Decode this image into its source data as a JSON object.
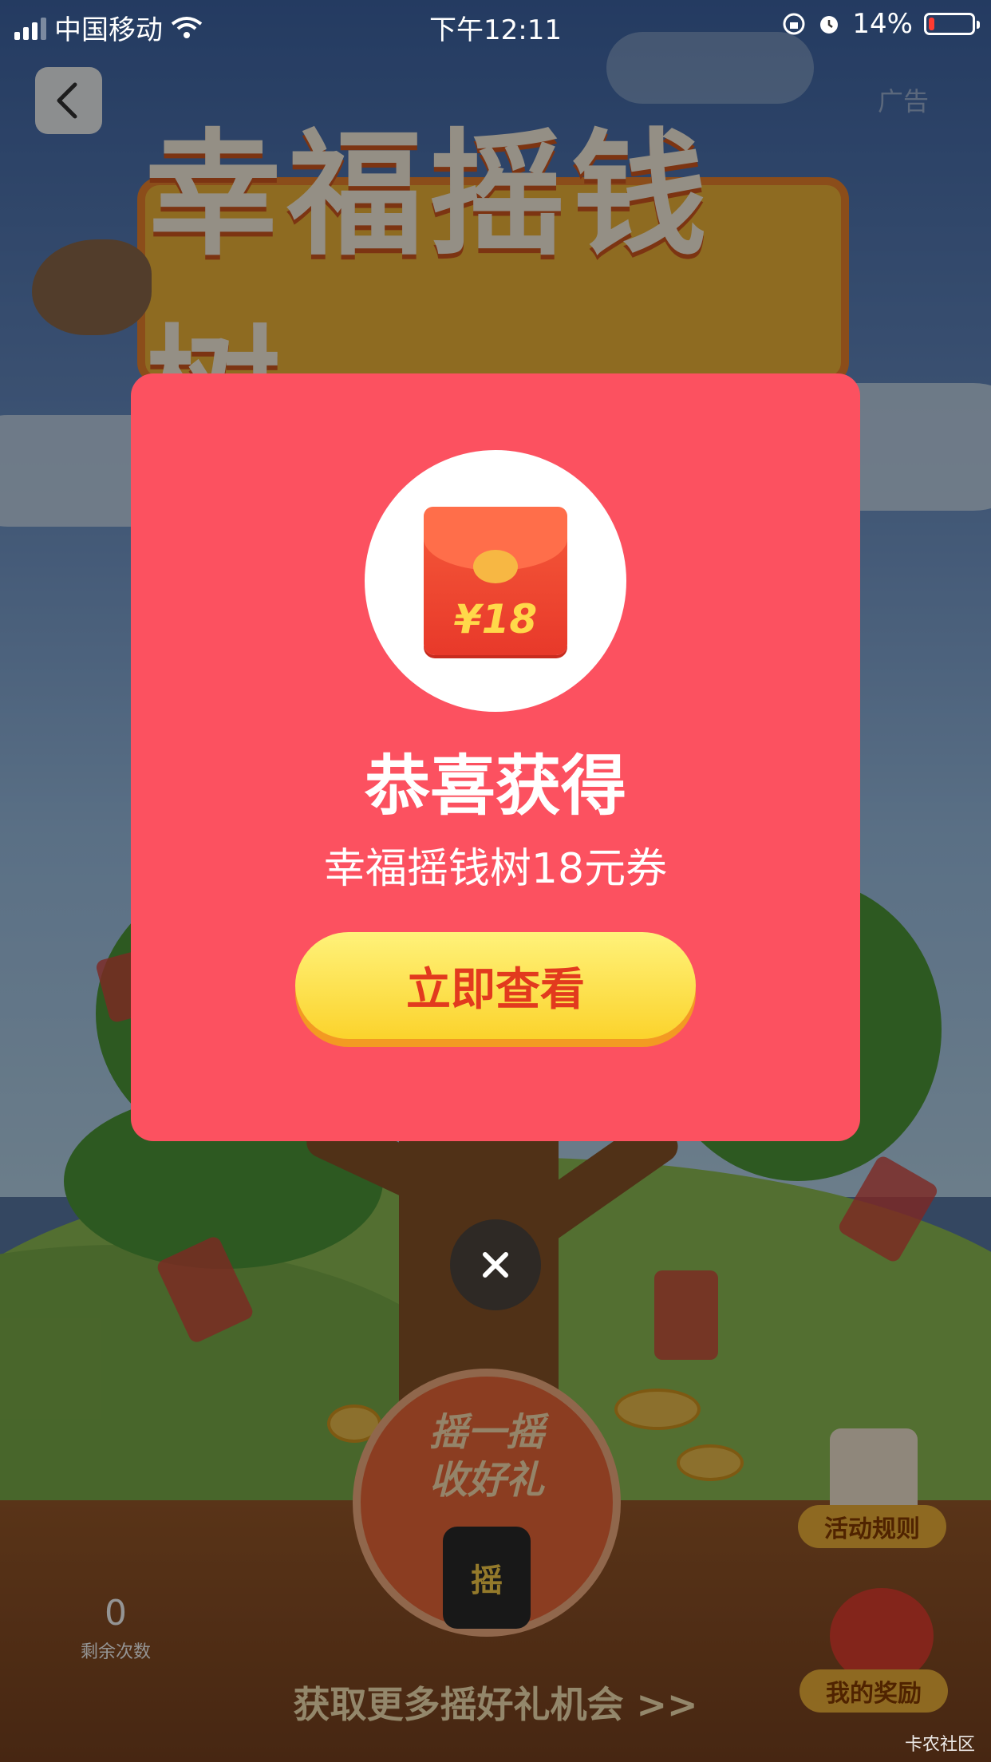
{
  "status_bar": {
    "carrier": "中国移动",
    "time": "下午12:11",
    "battery": "14%",
    "battery_level": 0.14
  },
  "header": {
    "ad_label": "广告"
  },
  "game": {
    "banner_title": "幸福摇钱树",
    "shake_line1": "摇一摇",
    "shake_line2": "收好礼",
    "phone_glyph": "摇",
    "rules_label": "活动规则",
    "my_rewards_label": "我的奖励",
    "remaining_count": "0",
    "remaining_label": "剩余次数",
    "more_chances": "获取更多摇好礼机会 >>"
  },
  "modal": {
    "envelope_amount": "¥18",
    "title": "恭喜获得",
    "subtitle": "幸福摇钱树18元券",
    "view_button": "立即查看"
  },
  "watermark": "卡农社区",
  "colors": {
    "modal_bg": "#fc5160",
    "button_yellow": "#fbd32c",
    "button_text": "#e23a1e"
  }
}
